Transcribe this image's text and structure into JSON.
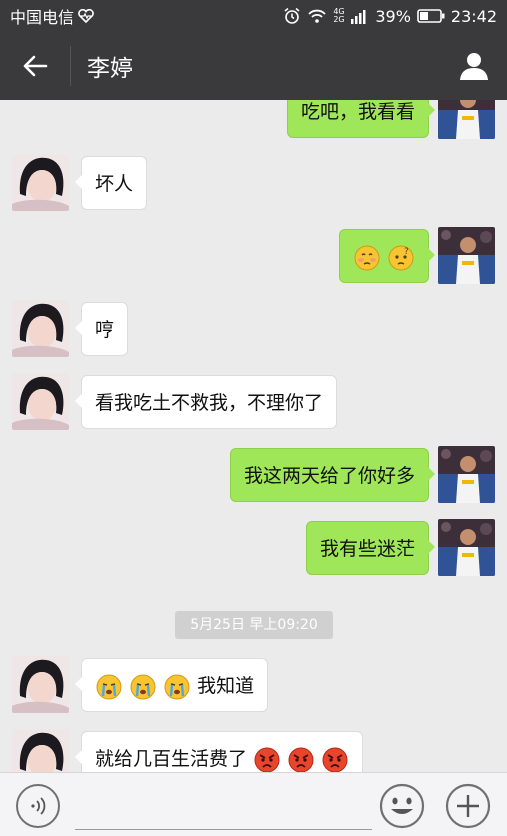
{
  "status_bar": {
    "carrier": "中国电信",
    "network": "4G 2G",
    "battery": "39%",
    "time": "23:42"
  },
  "header": {
    "title": "李婷"
  },
  "messages": [
    {
      "side": "right",
      "text": "吃吧，我看看"
    },
    {
      "side": "left",
      "text": "坏人"
    },
    {
      "side": "right",
      "emojis": [
        "shy-emoji",
        "confused-emoji"
      ]
    },
    {
      "side": "left",
      "text": "哼"
    },
    {
      "side": "left",
      "text": "看我吃土不救我，不理你了"
    },
    {
      "side": "right",
      "text": "我这两天给了你好多"
    },
    {
      "side": "right",
      "text": "我有些迷茫"
    },
    {
      "side": "left",
      "emojis": [
        "crying-emoji",
        "crying-emoji",
        "crying-emoji"
      ],
      "text": "我知道"
    },
    {
      "side": "left",
      "text": "就给几百生活费了",
      "emojis_after": [
        "angry-emoji",
        "angry-emoji",
        "angry-emoji"
      ]
    }
  ],
  "timestamp": "5月25日 早上09:20",
  "colors": {
    "bar_bg": "#3a3a3c",
    "chat_bg": "#ebebeb",
    "bubble_right": "#9fe658",
    "bubble_left": "#ffffff"
  },
  "input_bar": {
    "voice_icon": "voice-icon",
    "emoji_icon": "emoji-icon",
    "plus_icon": "plus-icon"
  }
}
